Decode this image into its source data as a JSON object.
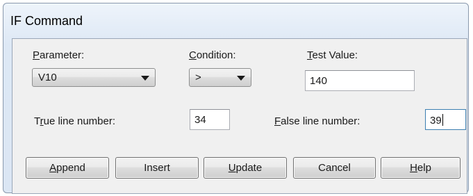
{
  "window": {
    "title": "IF Command"
  },
  "parameter": {
    "label_accel": "P",
    "label_rest": "arameter:",
    "value": "V10",
    "arrow_icon": "chevron-down-icon"
  },
  "condition": {
    "label_accel": "C",
    "label_rest": "ondition:",
    "value": ">",
    "arrow_icon": "chevron-down-icon"
  },
  "test_value": {
    "label_accel": "T",
    "label_rest": "est Value:",
    "value": "140"
  },
  "true_line": {
    "label_pre": "T",
    "label_accel": "r",
    "label_rest": "ue line number:",
    "value": "34"
  },
  "false_line": {
    "label_accel": "F",
    "label_rest": "alse line number:",
    "value": "39"
  },
  "buttons": {
    "append": {
      "accel": "A",
      "rest": "ppend"
    },
    "insert": {
      "label": "Insert"
    },
    "update": {
      "accel": "U",
      "rest": "pdate"
    },
    "cancel": {
      "label": "Cancel"
    },
    "help": {
      "accel": "H",
      "rest": "elp"
    }
  }
}
